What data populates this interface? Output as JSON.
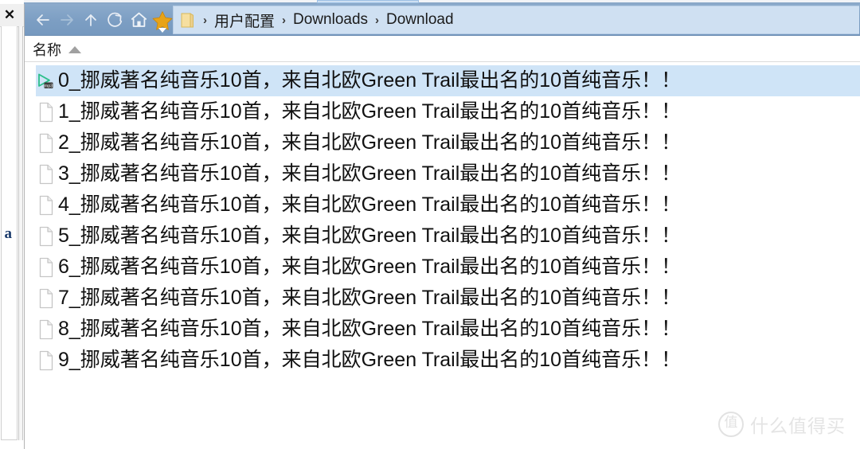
{
  "window": {
    "background_panel": {
      "close_label": "✕",
      "clipped_text": "et a"
    }
  },
  "toolbar": {
    "buttons": [
      {
        "name": "back",
        "glyph": "←"
      },
      {
        "name": "forward",
        "glyph": "→"
      },
      {
        "name": "up",
        "glyph": "↑"
      },
      {
        "name": "refresh",
        "glyph": "⟳"
      },
      {
        "name": "home",
        "glyph": "⌂"
      },
      {
        "name": "favorites",
        "glyph": "★"
      }
    ],
    "colors": {
      "toolbar_bg": "#7c9ec3",
      "crumb_bg": "#cfe0f2",
      "star": "#e8a317",
      "selection": "#cfe4f7"
    }
  },
  "breadcrumb": {
    "separator": "›",
    "items": [
      "用户配置",
      "Downloads",
      "Download"
    ]
  },
  "columns": {
    "name_header": "名称",
    "sort_direction": "ascending"
  },
  "files": [
    {
      "icon": "mp3-media-icon",
      "name": "0_挪威著名纯音乐10首，来自北欧Green Trail最出名的10首纯音乐！！",
      "selected": true
    },
    {
      "icon": "document-icon",
      "name": "1_挪威著名纯音乐10首，来自北欧Green Trail最出名的10首纯音乐！！",
      "selected": false
    },
    {
      "icon": "document-icon",
      "name": "2_挪威著名纯音乐10首，来自北欧Green Trail最出名的10首纯音乐！！",
      "selected": false
    },
    {
      "icon": "document-icon",
      "name": "3_挪威著名纯音乐10首，来自北欧Green Trail最出名的10首纯音乐！！",
      "selected": false
    },
    {
      "icon": "document-icon",
      "name": "4_挪威著名纯音乐10首，来自北欧Green Trail最出名的10首纯音乐！！",
      "selected": false
    },
    {
      "icon": "document-icon",
      "name": "5_挪威著名纯音乐10首，来自北欧Green Trail最出名的10首纯音乐！！",
      "selected": false
    },
    {
      "icon": "document-icon",
      "name": "6_挪威著名纯音乐10首，来自北欧Green Trail最出名的10首纯音乐！！",
      "selected": false
    },
    {
      "icon": "document-icon",
      "name": "7_挪威著名纯音乐10首，来自北欧Green Trail最出名的10首纯音乐！！",
      "selected": false
    },
    {
      "icon": "document-icon",
      "name": "8_挪威著名纯音乐10首，来自北欧Green Trail最出名的10首纯音乐！！",
      "selected": false
    },
    {
      "icon": "document-icon",
      "name": "9_挪威著名纯音乐10首，来自北欧Green Trail最出名的10首纯音乐！！",
      "selected": false
    }
  ],
  "watermark": {
    "logo_char": "值",
    "text": "什么值得买"
  }
}
